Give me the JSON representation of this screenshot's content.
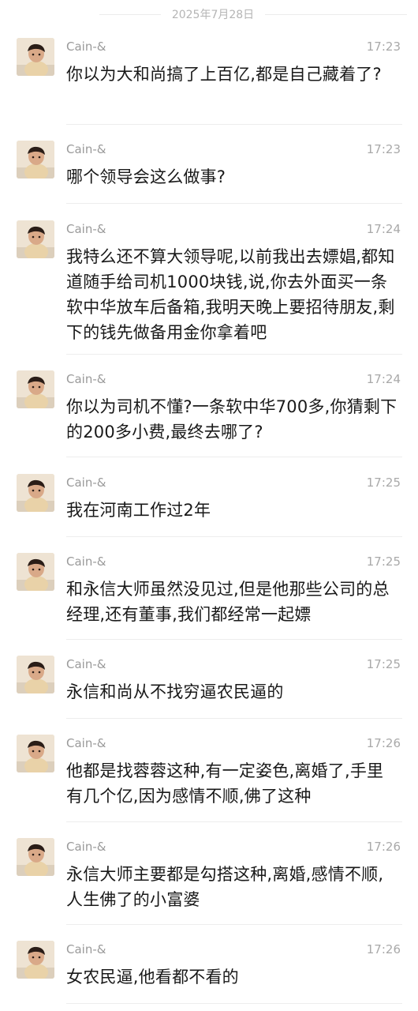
{
  "date_separator": "2025年7月28日",
  "messages": [
    {
      "sender": "Cain-&",
      "time": "17:23",
      "text": "你以为大和尚搞了上百亿,都是自己藏着了?"
    },
    {
      "sender": "Cain-&",
      "time": "17:23",
      "text": "哪个领导会这么做事?"
    },
    {
      "sender": "Cain-&",
      "time": "17:24",
      "text": "我特么还不算大领导呢,以前我出去嫖娼,都知道随手给司机1000块钱,说,你去外面买一条软中华放车后备箱,我明天晚上要招待朋友,剩下的钱先做备用金你拿着吧"
    },
    {
      "sender": "Cain-&",
      "time": "17:24",
      "text": "你以为司机不懂?一条软中华700多,你猜剩下的200多小费,最终去哪了?"
    },
    {
      "sender": "Cain-&",
      "time": "17:25",
      "text": "我在河南工作过2年"
    },
    {
      "sender": "Cain-&",
      "time": "17:25",
      "text": "和永信大师虽然没见过,但是他那些公司的总经理,还有董事,我们都经常一起嫖"
    },
    {
      "sender": "Cain-&",
      "time": "17:25",
      "text": "永信和尚从不找穷逼农民逼的"
    },
    {
      "sender": "Cain-&",
      "time": "17:26",
      "text": "他都是找蓉蓉这种,有一定姿色,离婚了,手里有几个亿,因为感情不顺,佛了这种"
    },
    {
      "sender": "Cain-&",
      "time": "17:26",
      "text": "永信大师主要都是勾搭这种,离婚,感情不顺,人生佛了的小富婆"
    },
    {
      "sender": "Cain-&",
      "time": "17:26",
      "text": "女农民逼,他看都不看的"
    }
  ]
}
